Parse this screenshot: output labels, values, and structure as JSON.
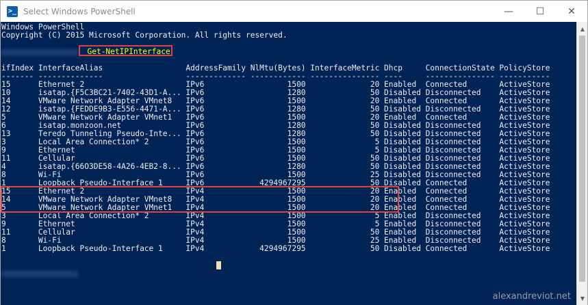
{
  "window": {
    "title": "Select Windows PowerShell",
    "app_icon": "powershell-icon",
    "minimize_glyph": "—",
    "maximize_glyph": "☐",
    "close_glyph": "✕"
  },
  "console": {
    "banner_line1": "Windows PowerShell",
    "banner_line2": "Copyright (C) 2015 Microsoft Corporation. All rights reserved.",
    "command": "Get-NetIPInterface",
    "header": "ifIndex InterfaceAlias                  AddressFamily NlMtu(Bytes) InterfaceMetric Dhcp     ConnectionState PolicyStore",
    "separator": "------- --------------                  ------------- ------------ --------------- ----     --------------- -----------",
    "rows": [
      "15      Ethernet 2                      IPv6                  1500              20 Enabled  Connected       ActiveStore",
      "10      isatap.{F5C3BC21-7402-43D1-A... IPv6                  1280              50 Disabled Disconnected    ActiveStore",
      "14      VMware Network Adapter VMnet8   IPv6                  1500              20 Enabled  Connected       ActiveStore",
      "12      isatap.{FEDDE9B3-E556-4471-A... IPv6                  1280              50 Disabled Disconnected    ActiveStore",
      "5       VMware Network Adapter VMnet1   IPv6                  1500              20 Enabled  Connected       ActiveStore",
      "6       isatap.monzoon.net              IPv6                  1280              50 Disabled Disconnected    ActiveStore",
      "13      Teredo Tunneling Pseudo-Inte... IPv6                  1280              50 Disabled Disconnected    ActiveStore",
      "3       Local Area Connection* 2        IPv6                  1500               5 Disabled Disconnected    ActiveStore",
      "9       Ethernet                        IPv6                  1500               5 Disabled Disconnected    ActiveStore",
      "11      Cellular                        IPv6                  1500              50 Disabled Disconnected    ActiveStore",
      "4       isatap.{66O3DE58-4A26-4EB2-8... IPv6                  1280              50 Disabled Disconnected    ActiveStore",
      "8       Wi-Fi                           IPv6                  1500              25 Disabled Disconnected    ActiveStore",
      "1       Loopback Pseudo-Interface 1     IPv6            4294967295              50 Disabled Connected       ActiveStore",
      "15      Ethernet 2                      IPv4                  1500              20 Enabled  Connected       ActiveStore",
      "14      VMware Network Adapter VMnet8   IPv4                  1500              20 Enabled  Connected       ActiveStore",
      "5       VMware Network Adapter VMnet1   IPv4                  1500              20 Enabled  Connected       ActiveStore",
      "3       Local Area Connection* 2        IPv4                  1500               5 Enabled  Disconnected    ActiveStore",
      "9       Ethernet                        IPv4                  1500               5 Enabled  Disconnected    ActiveStore",
      "11      Cellular                        IPv4                  1500              50 Enabled  Disconnected    ActiveStore",
      "8       Wi-Fi                           IPv4                  1500              25 Enabled  Disconnected    ActiveStore",
      "1       Loopback Pseudo-Interface 1     IPv4            4294967295              50 Disabled Connected       ActiveStore"
    ]
  },
  "watermark": "alexandreviot.net",
  "colors": {
    "console_bg": "#012456",
    "console_fg": "#eeedf0",
    "command_fg": "#ffff00",
    "highlight_box": "#e04040",
    "cursor": "#f5deb3"
  }
}
